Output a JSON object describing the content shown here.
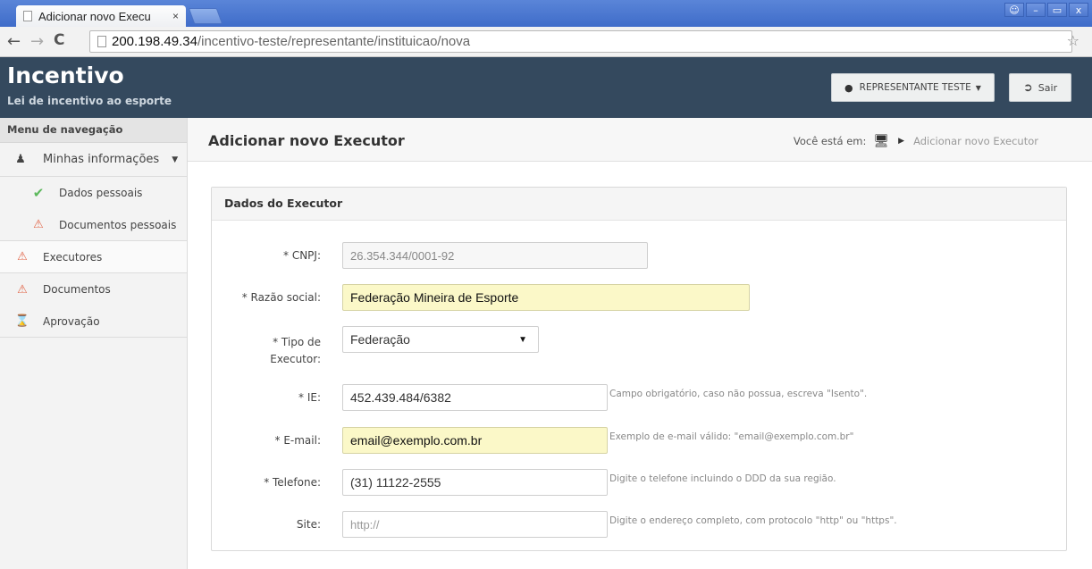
{
  "browser": {
    "tab_title": "Adicionar novo Execu",
    "tab_close": "×",
    "url_host": "200.198.49.34",
    "url_path": "/incentivo-teste/representante/instituicao/nova",
    "win_min": "–",
    "win_max": "▭",
    "win_close": "x"
  },
  "header": {
    "title": "Incentivo",
    "subtitle": "Lei de incentivo ao esporte",
    "user_label": "REPRESENTANTE TESTE",
    "logout_label": "Sair"
  },
  "sidebar": {
    "heading": "Menu de navegação",
    "group_label": "Minhas informações",
    "items": [
      {
        "label": "Dados pessoais",
        "icon": "check-icon"
      },
      {
        "label": "Documentos pessoais",
        "icon": "warning-icon"
      },
      {
        "label": "Executores",
        "icon": "warning-icon"
      },
      {
        "label": "Documentos",
        "icon": "warning-icon"
      },
      {
        "label": "Aprovação",
        "icon": "hourglass-icon"
      }
    ]
  },
  "page": {
    "title": "Adicionar novo Executor",
    "breadcrumb_prefix": "Você está em:",
    "breadcrumb_current": "Adicionar novo Executor"
  },
  "form": {
    "panel_title": "Dados do Executor",
    "cnpj": {
      "label": "* CNPJ:",
      "value": "26.354.344/0001-92"
    },
    "razao": {
      "label": "* Razão social:",
      "value": "Federação Mineira de Esporte"
    },
    "tipo": {
      "label_line1": "* Tipo de",
      "label_line2": "Executor:",
      "value": "Federação"
    },
    "ie": {
      "label": "* IE:",
      "value": "452.439.484/6382",
      "help": "Campo obrigatório, caso não possua, escreva \"Isento\"."
    },
    "email": {
      "label": "* E-mail:",
      "value": "email@exemplo.com.br",
      "help": "Exemplo de e-mail válido: \"email@exemplo.com.br\""
    },
    "telefone": {
      "label": "* Telefone:",
      "value": "(31) 11122-2555",
      "help": "Digite o telefone incluindo o DDD da sua região."
    },
    "site": {
      "label": "Site:",
      "placeholder": "http://",
      "help": "Digite o endereço completo, com protocolo \"http\" ou \"https\"."
    }
  }
}
